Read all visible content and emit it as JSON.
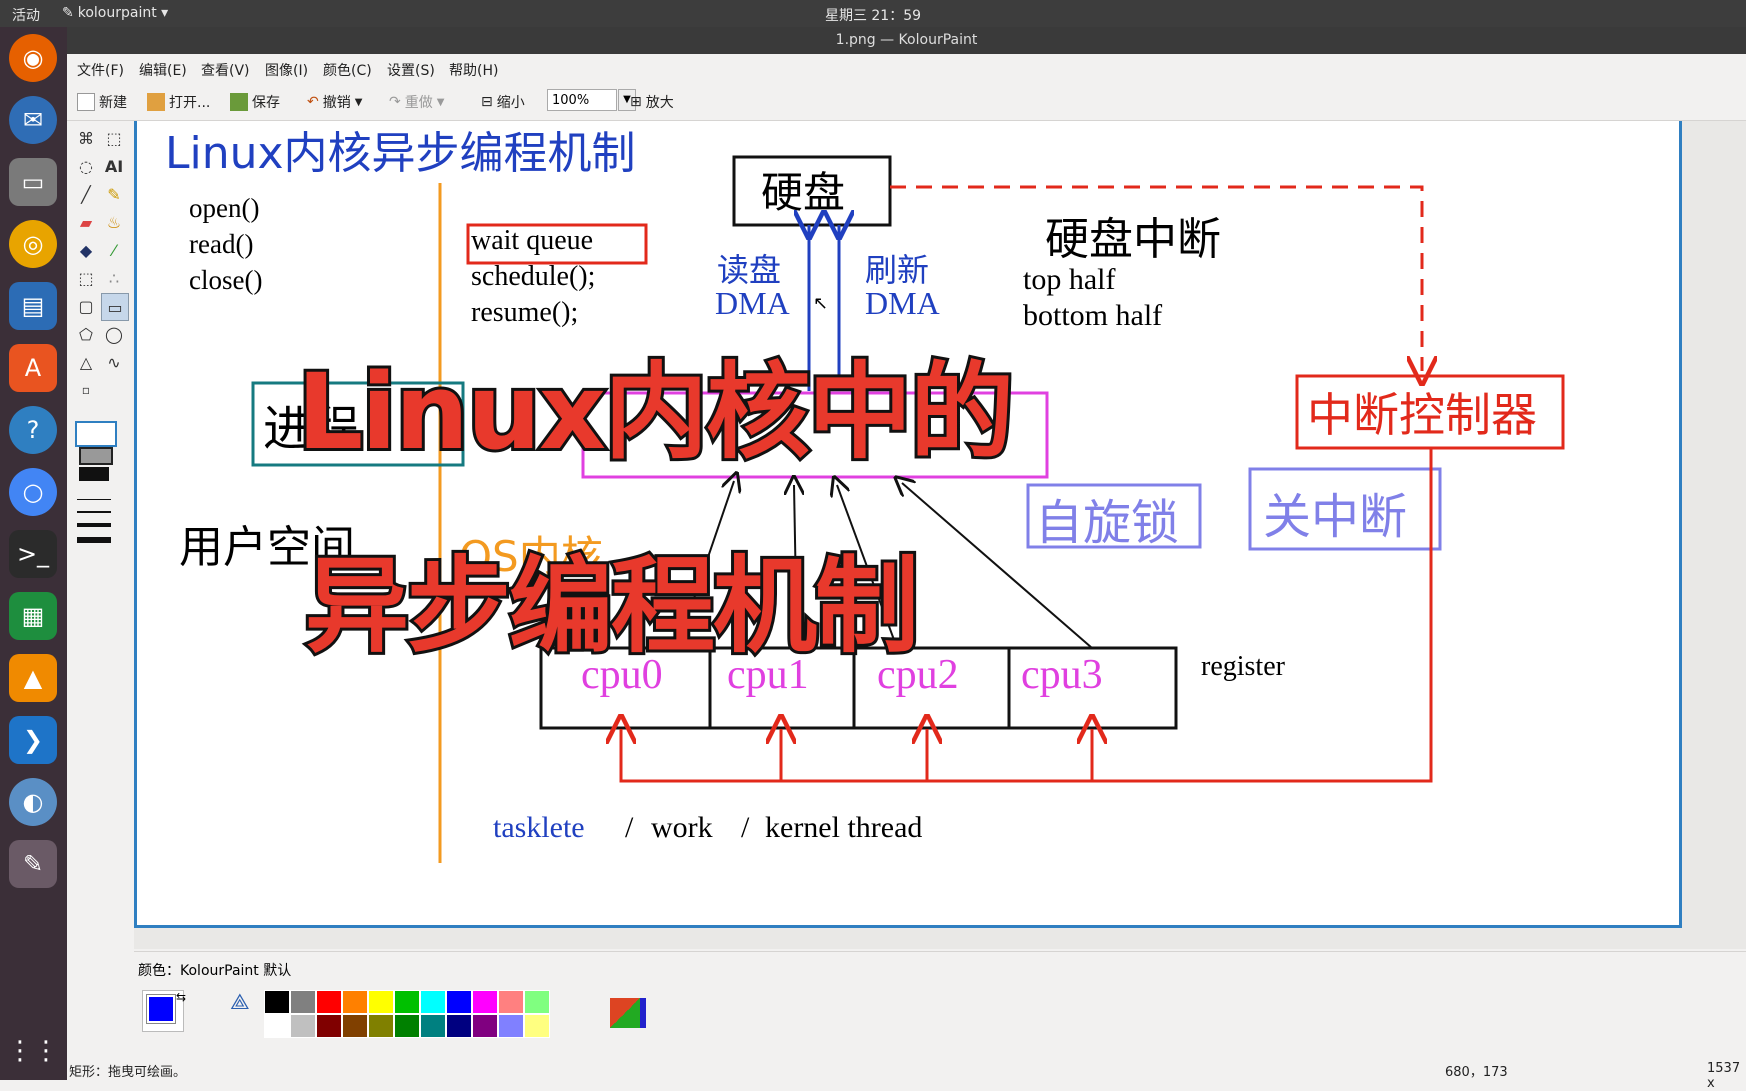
{
  "topbar": {
    "activities": "活动",
    "app_name": "kolourpaint ▾",
    "clock": "星期三 21：59"
  },
  "window": {
    "title": "1.png — KolourPaint"
  },
  "menu": [
    "文件(F)",
    "编辑(E)",
    "查看(V)",
    "图像(I)",
    "颜色(C)",
    "设置(S)",
    "帮助(H)"
  ],
  "toolbar": {
    "new": "新建",
    "open": "打开...",
    "save": "保存",
    "undo": "撤销",
    "redo": "重做",
    "zoom_out": "缩小",
    "zoom": "100%",
    "zoom_in": "放大"
  },
  "slide": {
    "title": "Linux内核异步编程机制",
    "syscalls": [
      "open()",
      "read()",
      "close()"
    ],
    "wait_queue": "wait  queue",
    "schedule": "schedule();",
    "resume": "resume();",
    "disk": "硬盘",
    "read_disk": "读盘",
    "refresh": "刷新",
    "dma1": "DMA",
    "dma2": "DMA",
    "disk_interrupt": "硬盘中断",
    "top_half": "top  half",
    "bottom_half": "bottom  half",
    "irq_controller": "中断控制器",
    "spinlock": "自旋锁",
    "disable_irq": "关中断",
    "process": "进程",
    "user_space": "用户空间",
    "os_kernel": "OS内核",
    "cpus": [
      "cpu0",
      "cpu1",
      "cpu2",
      "cpu3"
    ],
    "register": "register",
    "tasklet": "tasklete",
    "slash1": "/",
    "work": "work",
    "slash2": "/",
    "kernel_thread": "kernel  thread"
  },
  "overlay": {
    "line1": "Linux内核中的",
    "line2": "异步编程机制"
  },
  "colors": {
    "label": "颜色：KolourPaint 默认",
    "palette_top": [
      "#000000",
      "#808080",
      "#ff0000",
      "#ff8000",
      "#ffff00",
      "#00c000",
      "#00ffff",
      "#0000ff",
      "#ff00ff",
      "#ff8080",
      "#80ff80"
    ],
    "palette_bottom": [
      "#ffffff",
      "#c0c0c0",
      "#800000",
      "#804000",
      "#808000",
      "#008000",
      "#008080",
      "#000080",
      "#800080",
      "#8080ff",
      "#ffff80"
    ],
    "foreground": "#0000ff"
  },
  "status": {
    "hint": "矩形：拖曳可绘画。",
    "coords": "680，173",
    "size": "1537 x"
  }
}
